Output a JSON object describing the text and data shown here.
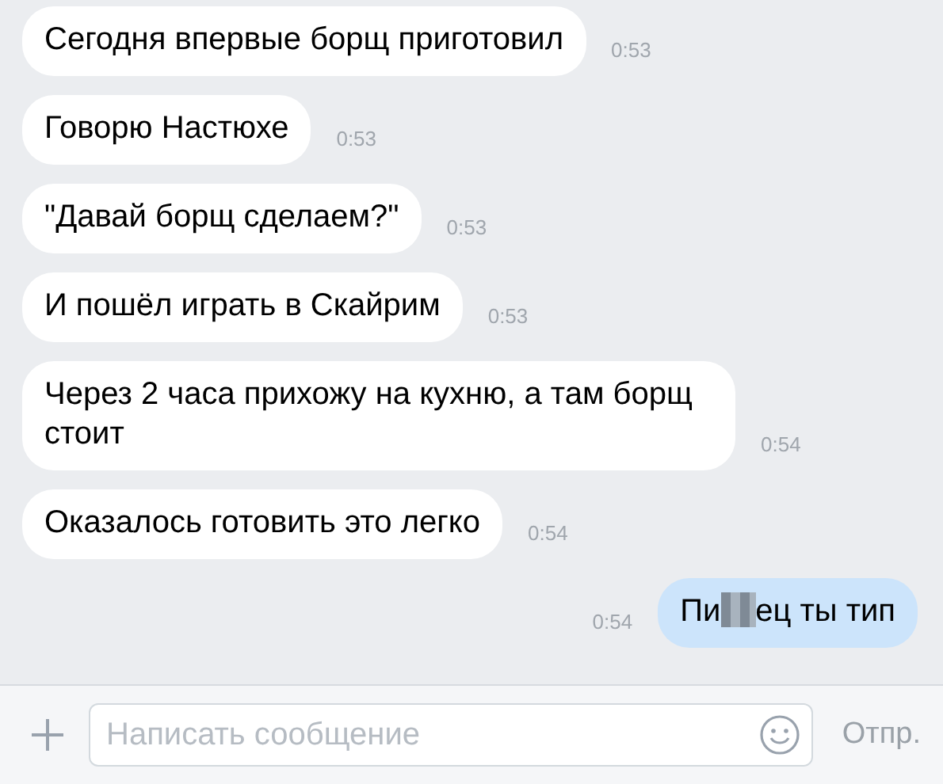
{
  "messages": [
    {
      "kind": "incoming",
      "text": "Сегодня впервые борщ приготовил",
      "time": "0:53"
    },
    {
      "kind": "incoming",
      "text": "Говорю Настюхе",
      "time": "0:53"
    },
    {
      "kind": "incoming",
      "text": "\"Давай борщ сделаем?\"",
      "time": "0:53"
    },
    {
      "kind": "incoming",
      "text": "И пошёл играть в Скайрим",
      "time": "0:53"
    },
    {
      "kind": "incoming",
      "text": "Через 2 часа прихожу на кухню, а там борщ стоит",
      "time": "0:54"
    },
    {
      "kind": "incoming",
      "text": "Оказалось готовить это легко",
      "time": "0:54"
    },
    {
      "kind": "outgoing",
      "text_before": "Пи",
      "censored": true,
      "text_after": "ец ты тип",
      "time": "0:54"
    }
  ],
  "composer": {
    "placeholder": "Написать сообщение",
    "send_label": "Отпр."
  }
}
